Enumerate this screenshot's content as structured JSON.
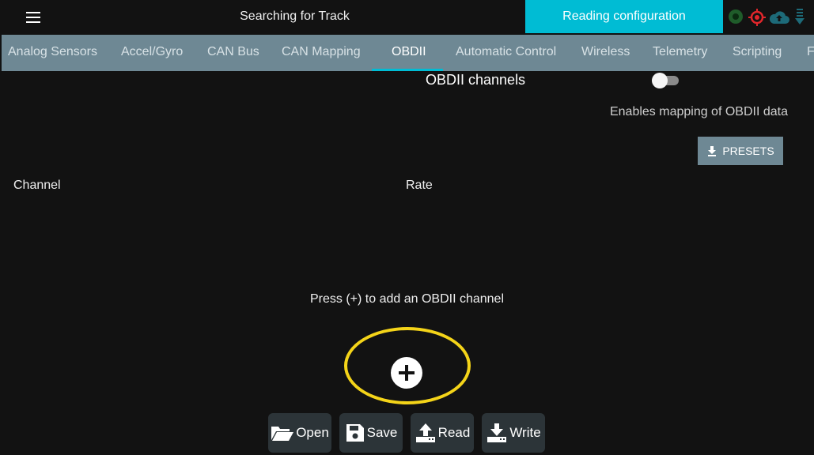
{
  "header": {
    "track_status": "Searching for Track",
    "config_status": "Reading configuration",
    "status_icons": [
      "gps-dot-icon",
      "target-icon",
      "cloud-upload-icon",
      "download-arrow-icon"
    ]
  },
  "tabs": [
    {
      "label": "Analog Sensors",
      "active": false
    },
    {
      "label": "Accel/Gyro",
      "active": false
    },
    {
      "label": "CAN Bus",
      "active": false
    },
    {
      "label": "CAN Mapping",
      "active": false
    },
    {
      "label": "OBDII",
      "active": true
    },
    {
      "label": "Automatic Control",
      "active": false
    },
    {
      "label": "Wireless",
      "active": false
    },
    {
      "label": "Telemetry",
      "active": false
    },
    {
      "label": "Scripting",
      "active": false
    },
    {
      "label": "F",
      "active": false
    }
  ],
  "obdii": {
    "title": "OBDII channels",
    "enabled": false,
    "enable_description": "Enables mapping of OBDII data",
    "presets_label": "PRESETS",
    "columns": [
      "Channel",
      "Rate"
    ],
    "empty_message": "Press (+) to add an OBDII channel"
  },
  "actions": {
    "open": "Open",
    "save": "Save",
    "read": "Read",
    "write": "Write"
  },
  "colors": {
    "background": "#121212",
    "accent": "#00bcd4",
    "tab_bar": "#6e8894",
    "highlight": "#f4d419",
    "button": "#2c3438"
  }
}
